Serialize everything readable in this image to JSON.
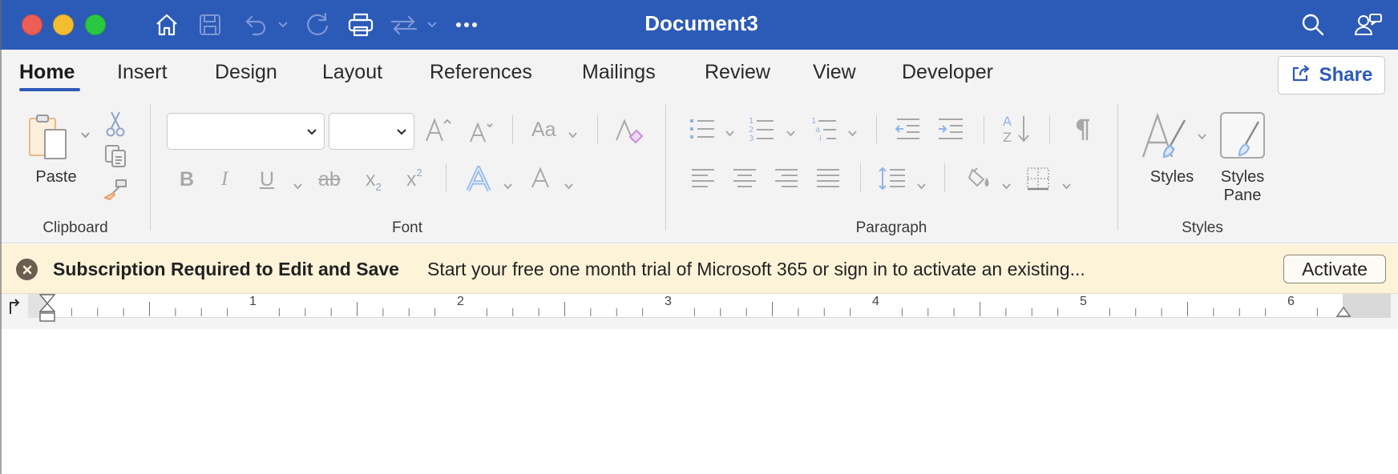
{
  "window": {
    "title": "Document3"
  },
  "tabs": [
    {
      "label": "Home",
      "active": true
    },
    {
      "label": "Insert"
    },
    {
      "label": "Design"
    },
    {
      "label": "Layout"
    },
    {
      "label": "References"
    },
    {
      "label": "Mailings"
    },
    {
      "label": "Review"
    },
    {
      "label": "View"
    },
    {
      "label": "Developer"
    }
  ],
  "share": {
    "label": "Share"
  },
  "ribbon": {
    "clipboard": {
      "paste_label": "Paste",
      "group_label": "Clipboard"
    },
    "font": {
      "font_name": "",
      "font_size": "",
      "change_case_label": "Aa",
      "group_label": "Font"
    },
    "paragraph": {
      "group_label": "Paragraph"
    },
    "styles": {
      "styles_label": "Styles",
      "styles_pane_label_1": "Styles",
      "styles_pane_label_2": "Pane",
      "group_label": "Styles"
    }
  },
  "notification": {
    "title": "Subscription Required to Edit and Save",
    "message": "Start your free one month trial of Microsoft 365 or sign in to activate an existing...",
    "button": "Activate"
  },
  "ruler": {
    "numbers": [
      "1",
      "2",
      "3",
      "4",
      "5",
      "6"
    ]
  },
  "colors": {
    "titlebar": "#2c5ab7",
    "accent": "#2c5ab7",
    "notification_bg": "#fcf3d9"
  }
}
